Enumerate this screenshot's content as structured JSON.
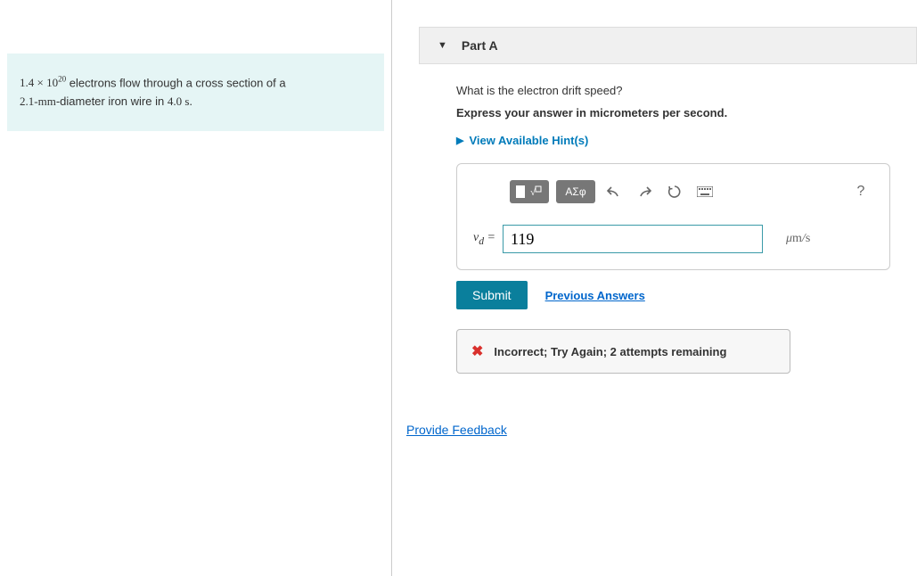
{
  "problem": {
    "coefficient": "1.4",
    "exponent_base": "10",
    "exponent_power": "20",
    "text_mid": " electrons flow through a cross section of a ",
    "diameter": "2.1",
    "diameter_unit": "mm",
    "text_tail": "-diameter iron wire in ",
    "time": "4.0",
    "time_unit": "s",
    "period": "."
  },
  "part": {
    "title": "Part A",
    "question": "What is the electron drift speed?",
    "instruction": "Express your answer in micrometers per second.",
    "hints_label": "View Available Hint(s)"
  },
  "toolbar": {
    "symbols": "ΑΣφ"
  },
  "answer": {
    "variable": "v",
    "subscript": "d",
    "equals": " = ",
    "value": "119",
    "unit_prefix": "μ",
    "unit_mid": "m",
    "unit_slash": "/",
    "unit_suffix": "s"
  },
  "buttons": {
    "submit": "Submit",
    "previous": "Previous Answers"
  },
  "feedback": {
    "text": "Incorrect; Try Again; 2 attempts remaining"
  },
  "provide_feedback": "Provide Feedback"
}
